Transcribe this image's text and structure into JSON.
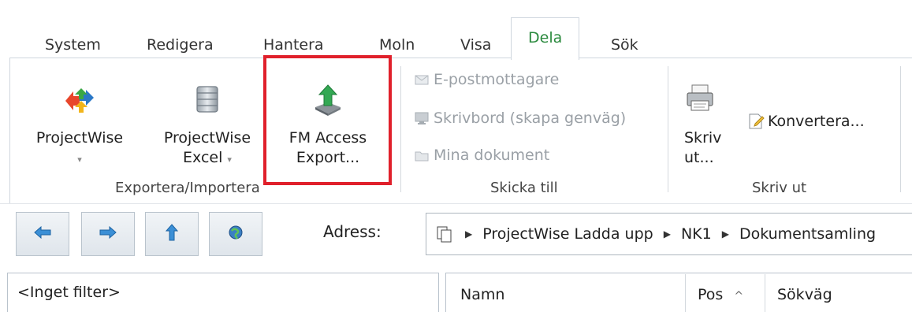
{
  "tabs": [
    {
      "label": "System"
    },
    {
      "label": "Redigera"
    },
    {
      "label": "Hantera"
    },
    {
      "label": "Moln"
    },
    {
      "label": "Visa"
    },
    {
      "label": "Dela",
      "active": true
    },
    {
      "label": "Sök"
    }
  ],
  "ribbon": {
    "groups": {
      "export_import": {
        "label": "Exportera/Importera",
        "projectwise": {
          "label": "ProjectWise",
          "caret": "▾",
          "icon": "projectwise-arrows-icon"
        },
        "projectwise_excel": {
          "line1": "ProjectWise",
          "line2": "Excel",
          "caret": "▾",
          "icon": "database-icon"
        },
        "fm_access_export": {
          "line1": "FM Access",
          "line2": "Export...",
          "icon": "export-upload-icon"
        }
      },
      "send_to": {
        "label": "Skicka till",
        "items": [
          {
            "label": "E-postmottagare",
            "icon": "mail-icon"
          },
          {
            "label": "Skrivbord (skapa genväg)",
            "icon": "desktop-icon"
          },
          {
            "label": "Mina dokument",
            "icon": "documents-icon"
          }
        ]
      },
      "print": {
        "label": "Skriv ut",
        "print_button": {
          "line1": "Skriv",
          "line2": "ut...",
          "icon": "printer-icon"
        },
        "convert_button": {
          "label": "Konvertera...",
          "icon": "convert-document-icon"
        }
      }
    },
    "highlight_color": "#e0202b"
  },
  "navigation": {
    "buttons": [
      "back-arrow-icon",
      "forward-arrow-icon",
      "up-arrow-icon",
      "refresh-globe-icon"
    ],
    "address_label": "Adress:",
    "breadcrumb": [
      "ProjectWise Ladda upp",
      "NK1",
      "Dokumentsamling"
    ]
  },
  "filter_pane": {
    "value": "<Inget filter>"
  },
  "file_list": {
    "columns": [
      {
        "label": "Namn"
      },
      {
        "label": "Pos",
        "sort": "^"
      },
      {
        "label": "Sökväg"
      }
    ]
  }
}
